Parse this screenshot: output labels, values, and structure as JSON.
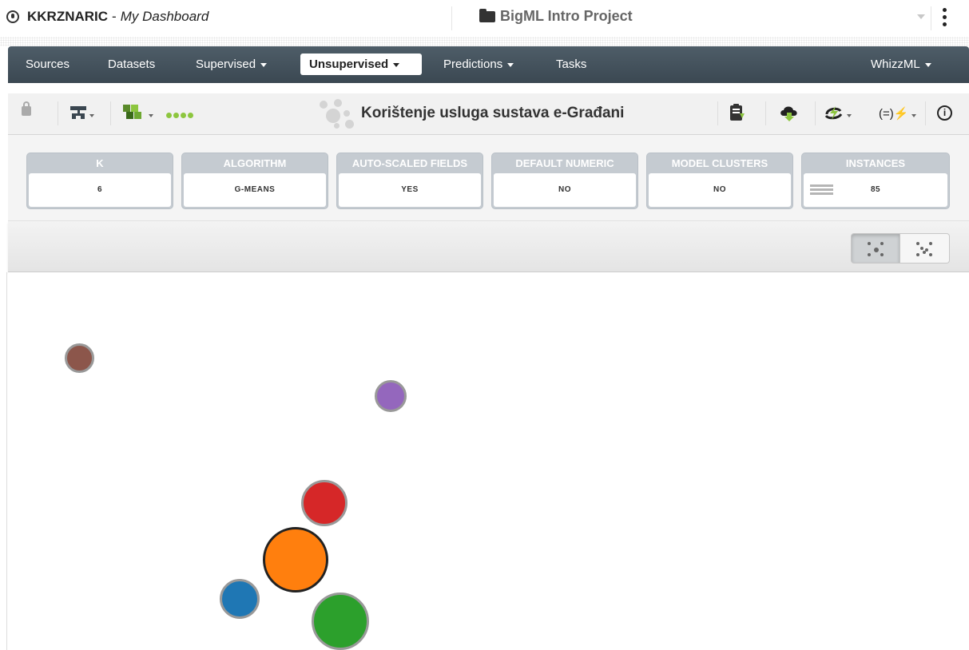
{
  "header": {
    "user_name": "KKRZNARIC",
    "separator": "-",
    "dashboard": "My Dashboard",
    "project": "BigML Intro Project"
  },
  "nav": {
    "items": [
      "Sources",
      "Datasets",
      "Supervised",
      "Unsupervised",
      "Predictions",
      "Tasks",
      "WhizzML"
    ],
    "active": "Unsupervised"
  },
  "toolbar": {
    "title": "Korištenje usluga sustava e-Građani",
    "info_glyph": "i"
  },
  "stats": [
    {
      "label": "K",
      "value": "6"
    },
    {
      "label": "ALGORITHM",
      "value": "G-MEANS"
    },
    {
      "label": "AUTO-SCALED FIELDS",
      "value": "YES"
    },
    {
      "label": "DEFAULT NUMERIC",
      "value": "NO"
    },
    {
      "label": "MODEL CLUSTERS",
      "value": "NO"
    },
    {
      "label": "INSTANCES",
      "value": "85"
    }
  ],
  "icons": {
    "user": "user-circle-icon",
    "project": "folder-icon",
    "menu": "kebab-menu-icon",
    "lock": "lock-icon",
    "tree": "tree-model-icon",
    "sample": "sample-icon",
    "status": "status-dots-icon",
    "cluster_title": "cluster-icon",
    "report": "clipboard-download-icon",
    "download": "cloud-download-icon",
    "actions": "lightning-actions-icon",
    "formula": "formula-icon",
    "info": "info-icon",
    "view_clusters": "cluster-view-icon",
    "view_centroids": "centroid-view-icon"
  },
  "colors": {
    "navbar": "#4e5d68",
    "status_green": "#8dc63f",
    "cluster_brown": "#8c564b",
    "cluster_purple": "#9467bd",
    "cluster_red": "#d62728",
    "cluster_orange": "#ff7f0e",
    "cluster_blue": "#1f77b4",
    "cluster_green": "#2ca02c"
  },
  "clusters": [
    {
      "color": "#8c564b",
      "selected": false
    },
    {
      "color": "#9467bd",
      "selected": false
    },
    {
      "color": "#d62728",
      "selected": false
    },
    {
      "color": "#ff7f0e",
      "selected": true
    },
    {
      "color": "#1f77b4",
      "selected": false
    },
    {
      "color": "#2ca02c",
      "selected": false
    }
  ]
}
